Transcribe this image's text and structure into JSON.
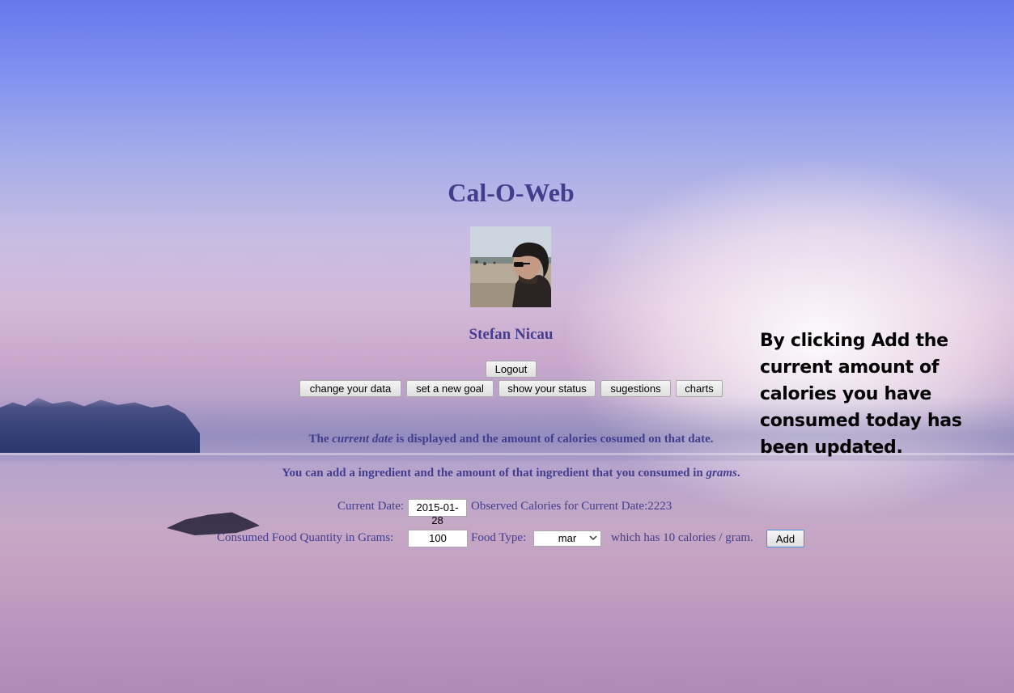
{
  "app": {
    "title": "Cal-O-Web"
  },
  "user": {
    "name": "Stefan Nicau",
    "avatar": "user-photo"
  },
  "nav": {
    "logout": "Logout",
    "change_data": "change your data",
    "new_goal": "set a new goal",
    "show_status": "show your status",
    "suggestions": "sugestions",
    "charts": "charts"
  },
  "info": {
    "line1_a": "The ",
    "line1_em": "current date",
    "line1_b": " is displayed and the amount of calories cosumed on that date.",
    "line2_a": "You can add a ingredient and the amount of that ingredient that you consumed in ",
    "line2_em": "grams",
    "line2_b": "."
  },
  "date_row": {
    "label": "Current Date:",
    "value": "2015-01-28",
    "observed_label": "Observed Calories for Current Date:",
    "observed_value": "2223"
  },
  "food_row": {
    "quantity_label": "Consumed Food Quantity in Grams:",
    "quantity_value": "100",
    "type_label": "Food Type:",
    "type_value": "mar",
    "calories_text": "which has 10 calories / gram.",
    "add_button": "Add"
  },
  "callout": {
    "text": "By clicking Add the current amount of calories you have consumed today has been updated."
  },
  "colors": {
    "text": "#433d8e",
    "sky_top": "#6678ec"
  }
}
